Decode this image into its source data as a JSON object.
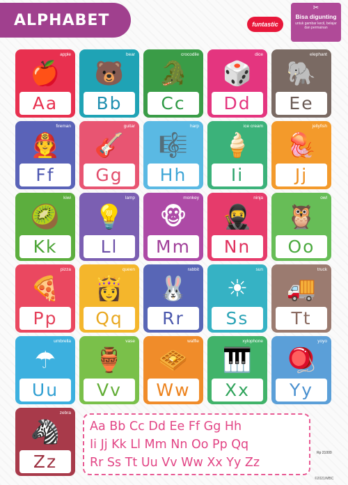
{
  "header": {
    "title": "ALPHABET",
    "brand": "funtastic",
    "badge_title": "Bisa digunting",
    "badge_subtitle": "untuk gambar kecil, belajar dan permainan",
    "scissors": "✂"
  },
  "cards": [
    {
      "word": "apple",
      "letter": "Aa",
      "icon": "apple-icon",
      "glyph": "🍎",
      "bg": "#e8304f",
      "text": "#e8304f"
    },
    {
      "word": "bear",
      "letter": "Bb",
      "icon": "bear-icon",
      "glyph": "🐻",
      "bg": "#1fa3b5",
      "text": "#1f8fb0"
    },
    {
      "word": "crocodile",
      "letter": "Cc",
      "icon": "crocodile-icon",
      "glyph": "🐊",
      "bg": "#3a9c47",
      "text": "#2f9a46"
    },
    {
      "word": "dice",
      "letter": "Dd",
      "icon": "dice-icon",
      "glyph": "🎲",
      "bg": "#e4357f",
      "text": "#e4357f"
    },
    {
      "word": "elephant",
      "letter": "Ee",
      "icon": "elephant-icon",
      "glyph": "🐘",
      "bg": "#7a6a63",
      "text": "#6b5b55"
    },
    {
      "word": "fireman",
      "letter": "Ff",
      "icon": "fireman-icon",
      "glyph": "👨‍🚒",
      "bg": "#5a63b8",
      "text": "#4c56b0"
    },
    {
      "word": "guitar",
      "letter": "Gg",
      "icon": "guitar-icon",
      "glyph": "🎸",
      "bg": "#e85572",
      "text": "#e24d6b"
    },
    {
      "word": "harp",
      "letter": "Hh",
      "icon": "harp-icon",
      "glyph": "🎼",
      "bg": "#5ab9e3",
      "text": "#3ea5d6"
    },
    {
      "word": "ice cream",
      "letter": "Ii",
      "icon": "ice-cream-icon",
      "glyph": "🍦",
      "bg": "#3bb27a",
      "text": "#2ca36b"
    },
    {
      "word": "jellyfish",
      "letter": "Jj",
      "icon": "jellyfish-icon",
      "glyph": "🪼",
      "bg": "#f39a2b",
      "text": "#ef8f1f"
    },
    {
      "word": "kiwi",
      "letter": "Kk",
      "icon": "kiwi-icon",
      "glyph": "🥝",
      "bg": "#5cae3e",
      "text": "#4aa334"
    },
    {
      "word": "lamp",
      "letter": "Ll",
      "icon": "lamp-icon",
      "glyph": "💡",
      "bg": "#7b5fb2",
      "text": "#6c4fa8"
    },
    {
      "word": "monkey",
      "letter": "Mm",
      "icon": "monkey-icon",
      "glyph": "🐵",
      "bg": "#ad4aa6",
      "text": "#a03f99"
    },
    {
      "word": "ninja",
      "letter": "Nn",
      "icon": "ninja-icon",
      "glyph": "🥷",
      "bg": "#e63b6b",
      "text": "#e0325f"
    },
    {
      "word": "owl",
      "letter": "Oo",
      "icon": "owl-icon",
      "glyph": "🦉",
      "bg": "#67bd57",
      "text": "#4caa40"
    },
    {
      "word": "pizza",
      "letter": "Pp",
      "icon": "pizza-icon",
      "glyph": "🍕",
      "bg": "#ea4860",
      "text": "#e4405a"
    },
    {
      "word": "queen",
      "letter": "Qq",
      "icon": "queen-icon",
      "glyph": "👸",
      "bg": "#f4b62c",
      "text": "#e9a820"
    },
    {
      "word": "rabbit",
      "letter": "Rr",
      "icon": "rabbit-icon",
      "glyph": "🐰",
      "bg": "#5866b6",
      "text": "#4b58ad"
    },
    {
      "word": "sun",
      "letter": "Ss",
      "icon": "sun-icon",
      "glyph": "☀",
      "bg": "#36b2c4",
      "text": "#2aa3b6"
    },
    {
      "word": "truck",
      "letter": "Tt",
      "icon": "truck-icon",
      "glyph": "🚚",
      "bg": "#9b7b70",
      "text": "#8a6a60"
    },
    {
      "word": "umbrella",
      "letter": "Uu",
      "icon": "umbrella-icon",
      "glyph": "☂",
      "bg": "#3cb0df",
      "text": "#2f9fd2"
    },
    {
      "word": "vase",
      "letter": "Vv",
      "icon": "vase-icon",
      "glyph": "🏺",
      "bg": "#7ac04a",
      "text": "#62ad36"
    },
    {
      "word": "waffle",
      "letter": "Ww",
      "icon": "waffle-icon",
      "glyph": "🧇",
      "bg": "#f08c2a",
      "text": "#ec821c"
    },
    {
      "word": "xylophone",
      "letter": "Xx",
      "icon": "xylophone-icon",
      "glyph": "🎹",
      "bg": "#41b36a",
      "text": "#31a45c"
    },
    {
      "word": "yoyo",
      "letter": "Yy",
      "icon": "yoyo-icon",
      "glyph": "🪀",
      "bg": "#5b9fd8",
      "text": "#4a90cf"
    },
    {
      "word": "zebra",
      "letter": "Zz",
      "icon": "zebra-icon",
      "glyph": "🦓",
      "bg": "#a83a4a",
      "text": "#9c3040"
    }
  ],
  "summary": {
    "line1": "Aa Bb Cc Dd Ee Ff Gg Hh",
    "line2": "Ii Jj Kk Ll Mm Nn Oo Pp Qq",
    "line3": "Rr Ss Tt Uu Vv Ww Xx Yy Zz"
  },
  "footer": {
    "price": "Rp 21000",
    "copyright": "©2021/MBC"
  }
}
